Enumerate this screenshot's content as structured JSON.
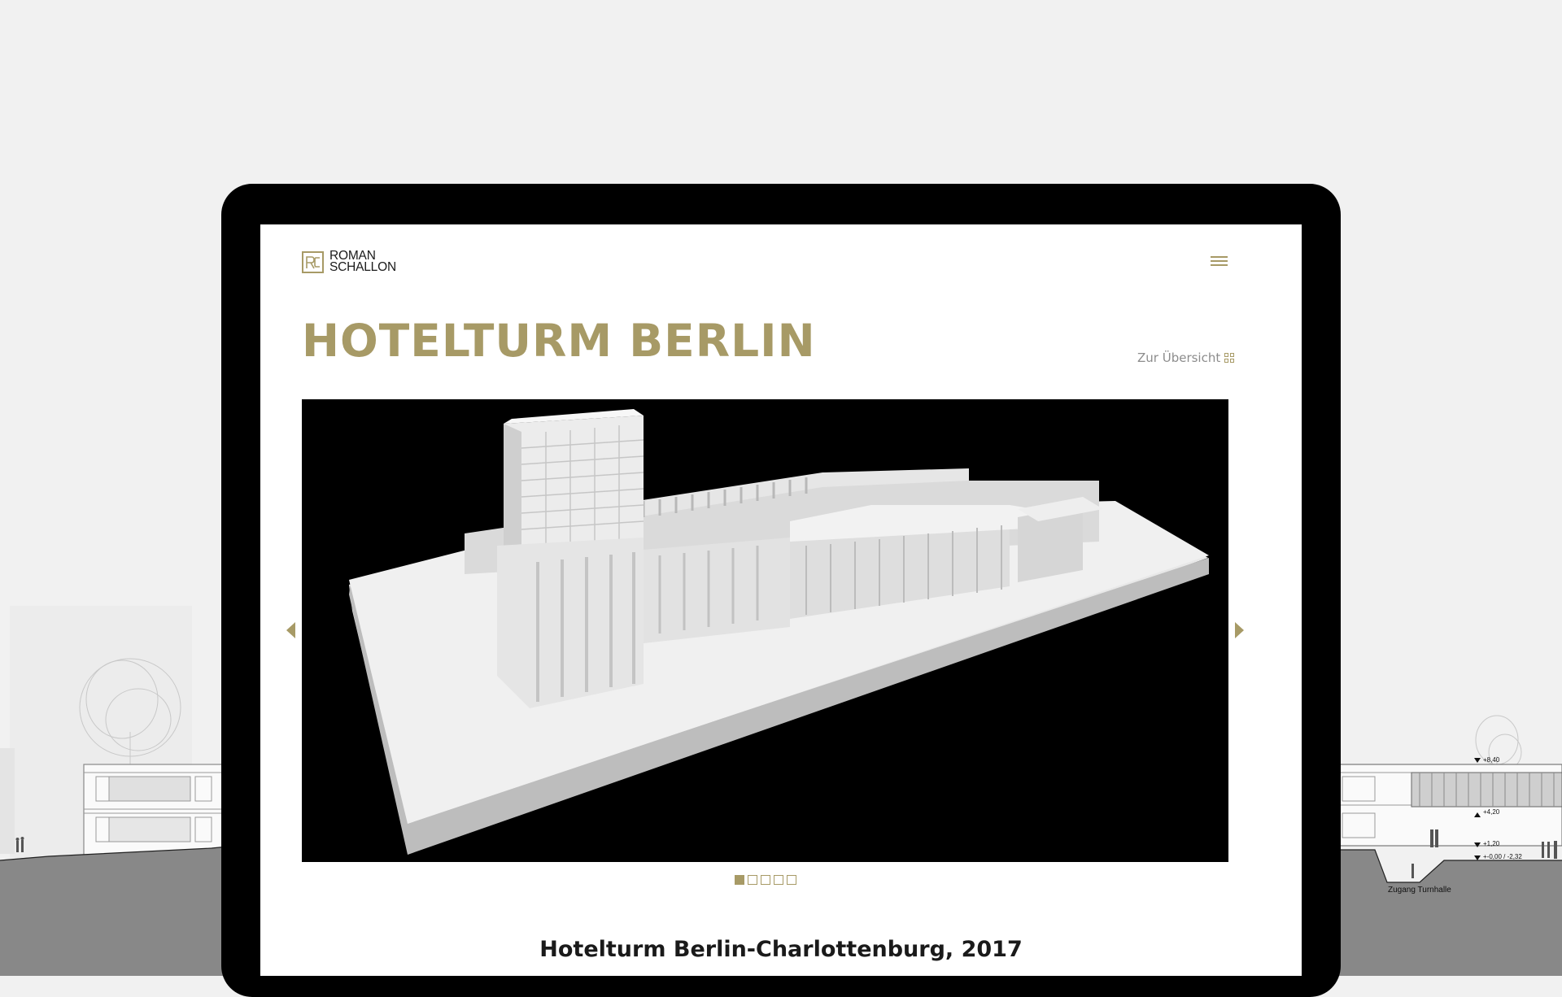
{
  "background": {
    "section_label": "Zugang Turnhalle",
    "levels": [
      "+8,40",
      "+4,20",
      "+1,20",
      "+-0,00 / -2,32"
    ]
  },
  "site": {
    "logo": {
      "line1": "ROMAN",
      "line2": "SCHALLON",
      "mark": "RS-monogram-icon"
    },
    "menu_icon": "hamburger-menu-icon"
  },
  "project": {
    "title": "HOTELTURM BERLIN",
    "overview_link": "Zur Übersicht",
    "overview_icon": "grid-icon",
    "subtitle": "Hotelturm Berlin-Charlottenburg, 2017"
  },
  "slider": {
    "image": "architectural-model-photo",
    "prev_icon": "arrow-left-icon",
    "next_icon": "arrow-right-icon",
    "slide_count": 5,
    "active_index": 0
  },
  "colors": {
    "accent": "#a79a66",
    "frame": "#000000",
    "background": "#f1f1f1"
  }
}
